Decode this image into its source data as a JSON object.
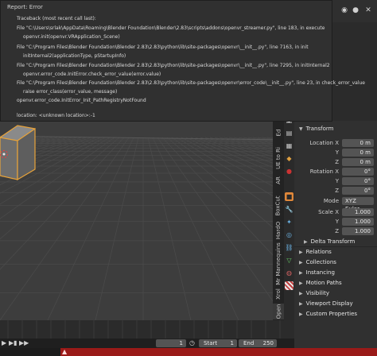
{
  "report": {
    "title": "Report: Error",
    "lines": [
      "Traceback (most recent call last):",
      "File \"C:\\Users\\srlak\\AppData\\Roaming\\Blender Foundation\\Blender\\2.83\\scripts\\addons\\openvr_streamer.py\", line 183, in execute",
      "openvr.init(openvr.VRApplication_Scene)",
      "File \"C:\\Program Files\\Blender Foundation\\Blender 2.83\\2.83\\python\\lib\\site-packages\\openvr\\__init__.py\", line 7163, in init",
      "initInternal2(applicationType, pStartupInfo)",
      "File \"C:\\Program Files\\Blender Foundation\\Blender 2.83\\2.83\\python\\lib\\site-packages\\openvr\\__init__.py\", line 7295, in initInternal2",
      "openvr.error_code.InitError.check_error_value(error.value)",
      "File \"C:\\Program Files\\Blender Foundation\\Blender 2.83\\2.83\\python\\lib\\site-packages\\openvr\\error_code\\__init__.py\", line 23, in check_error_value",
      "raise error_class(error_value, message)",
      "openvr.error_code.InitError_Init_PathRegistryNotFound",
      "location: <unknown location>:-1"
    ]
  },
  "sidebar_tabs": [
    "Ed",
    "UE to Ri",
    "AR",
    "BoxCut",
    "HardO",
    "Mr Mannequins",
    "Xrol",
    "Open"
  ],
  "transform": {
    "header": "Transform",
    "location_label": "Location X",
    "location": {
      "x": "0 m",
      "y": "0 m",
      "z": "0 m"
    },
    "rotation_label": "Rotation X",
    "rotation": {
      "x": "0°",
      "y": "0°",
      "z": "0°"
    },
    "mode_label": "Mode",
    "mode_value": "XYZ Euler",
    "scale_label": "Scale X",
    "scale": {
      "x": "1.000",
      "y": "1.000",
      "z": "1.000"
    },
    "axis_y": "Y",
    "axis_z": "Z",
    "delta": "Delta Transform"
  },
  "sections": [
    "Relations",
    "Collections",
    "Instancing",
    "Motion Paths",
    "Visibility",
    "Viewport Display",
    "Custom Properties"
  ],
  "timeline": {
    "current_frame": "1",
    "start_label": "Start",
    "start": "1",
    "end_label": "End",
    "end": "250"
  },
  "colors": {
    "error_bar": "#9a1a18",
    "selection_outline": "#e8a33a",
    "panel": "#303030",
    "viewport": "#3d3d3d"
  }
}
